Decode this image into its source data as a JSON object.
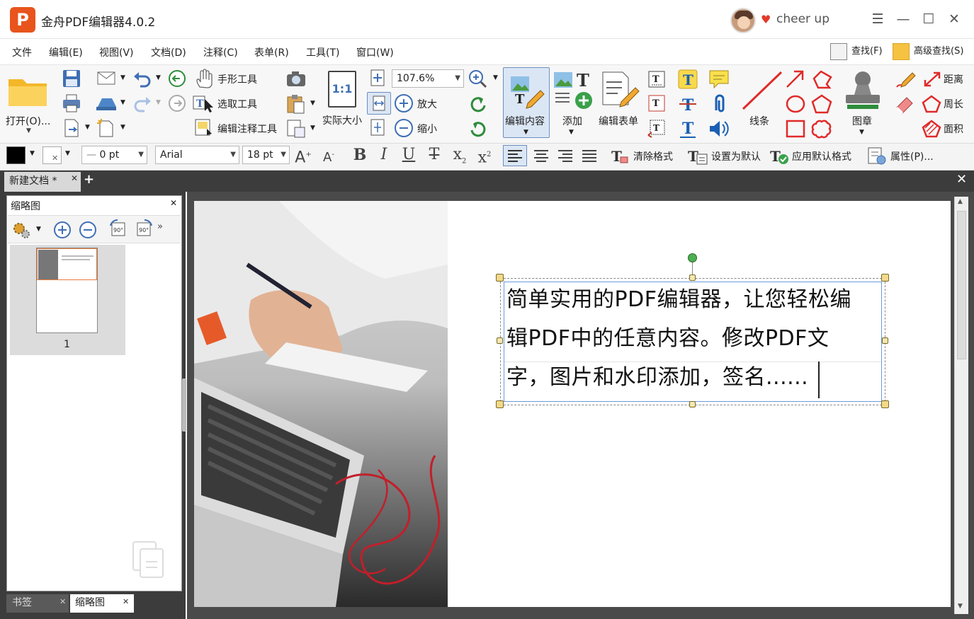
{
  "window": {
    "logo_letter": "P",
    "title": "金舟PDF编辑器4.0.2",
    "user_name": "cheer up",
    "controls": {
      "menu": "☰",
      "minimize": "—",
      "maximize": "☐",
      "close": "✕"
    }
  },
  "menubar": {
    "items": [
      "文件",
      "编辑(E)",
      "视图(V)",
      "文档(D)",
      "注释(C)",
      "表单(R)",
      "工具(T)",
      "窗口(W)"
    ],
    "find": "查找(F)",
    "advanced_find": "高级查找(S)"
  },
  "toolbar": {
    "open": "打开(O)...",
    "hand_tool": "手形工具",
    "select_tool": "选取工具",
    "edit_annotation_tool": "编辑注释工具",
    "actual_size": "实际大小",
    "actual_size_icon": "1:1",
    "zoom_value": "107.6%",
    "zoom_in": "放大",
    "zoom_out": "缩小",
    "edit_content": "编辑内容",
    "add": "添加",
    "edit_form": "编辑表单",
    "line": "线条",
    "stamp": "图章",
    "distance": "距离",
    "perimeter": "周长",
    "area": "面积"
  },
  "formatbar": {
    "line_width": "0 pt",
    "font_family": "Arial",
    "font_size": "18 pt",
    "clear_format": "清除格式",
    "set_default": "设置为默认",
    "apply_default": "应用默认格式",
    "properties": "属性(P)..."
  },
  "tabs": {
    "document_tab": "新建文档 *"
  },
  "left_panel": {
    "title": "缩略图",
    "page_number": "1",
    "bottom_tabs": [
      "书签",
      "缩略图"
    ]
  },
  "document": {
    "text_lines": [
      "简单实用的PDF编辑器，让您轻松编",
      "辑PDF中的任意内容。修改PDF文",
      "字，图片和水印添加，签名......"
    ]
  },
  "colors": {
    "accent": "#e8541c",
    "selection_border": "#6a9bd8",
    "panel_dark": "#3c3c3c"
  }
}
